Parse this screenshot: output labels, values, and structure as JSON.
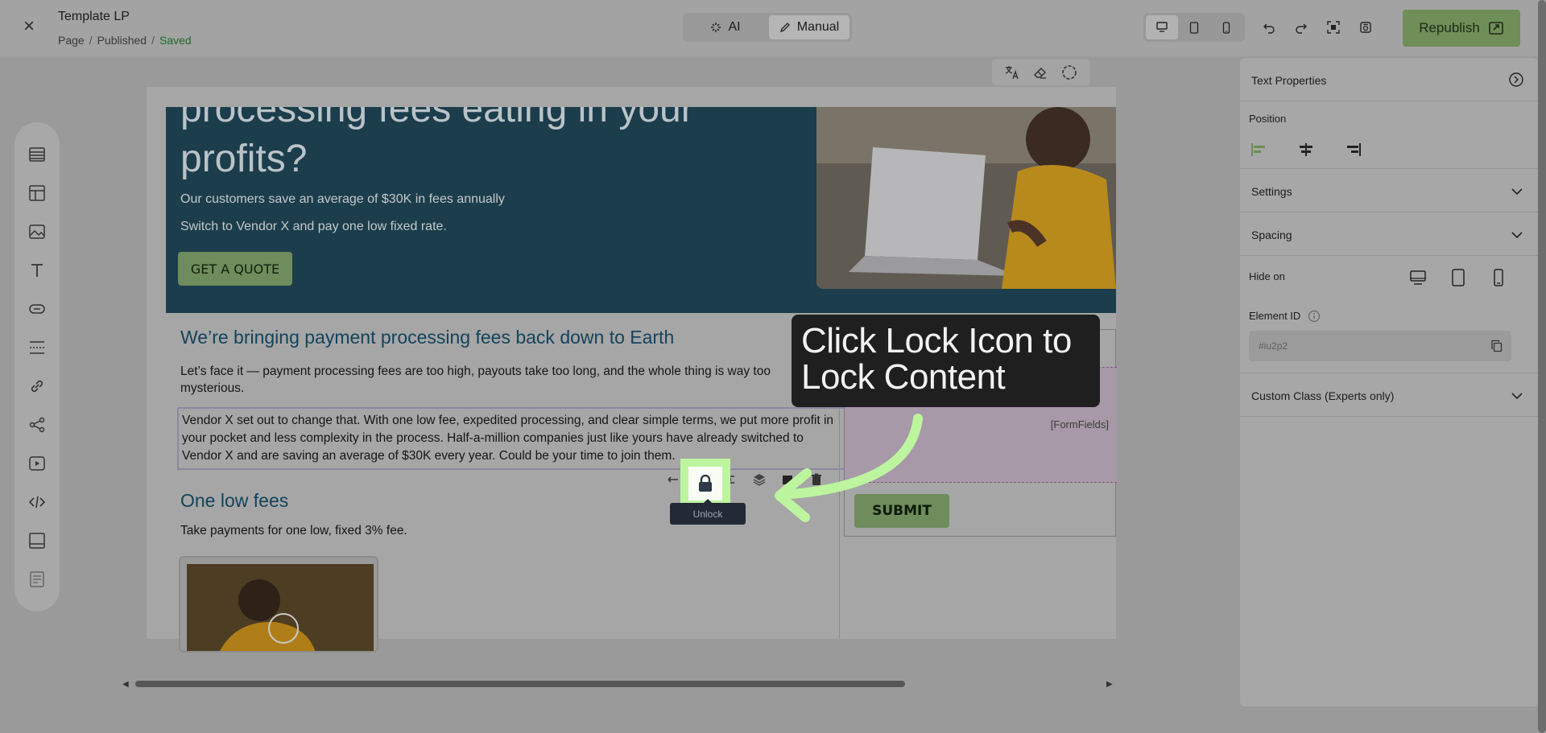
{
  "header": {
    "title": "Template LP",
    "breadcrumb": [
      "Page",
      "Published",
      "Saved"
    ],
    "breadcrumb_sep": "/",
    "modes": [
      {
        "label": "AI",
        "icon": "sparkle-icon"
      },
      {
        "label": "Manual",
        "icon": "pencil-icon"
      }
    ],
    "active_mode": "Manual",
    "republish_label": "Republish"
  },
  "canvas": {
    "hero_heading": "processing fees eating in your profits?",
    "hero_sub1": "Our customers save an average of $30K in fees annually",
    "hero_sub2": "Switch to Vendor X and pay one low fixed rate.",
    "quote_button": "GET A QUOTE",
    "section1_heading": "We’re bringing payment processing fees back down to Earth",
    "section1_p1": "Let’s face it — payment processing fees are too high, payouts take too long, and the whole thing is way too mysterious.",
    "section1_p2": "Vendor X set out to change that. With one low fee, expedited processing, and clear simple terms, we put more profit in your pocket and less complexity in the process. Half-a-million companies just like yours have already switched to Vendor X and are saving an average of $30K every year. Could be your time to join them.",
    "section2_heading": "One low fees",
    "section2_p": "Take payments for one low, fixed 3% fee.",
    "form_fields_label": "[FormFields]",
    "submit_button": "SUBMIT"
  },
  "element_toolbar": {
    "tooltip": "Unlock"
  },
  "callout": {
    "text": "Click Lock Icon to Lock Content"
  },
  "right_panel": {
    "title": "Text Properties",
    "position_label": "Position",
    "settings_label": "Settings",
    "spacing_label": "Spacing",
    "hide_on_label": "Hide on",
    "element_id_label": "Element ID",
    "element_id_value": "#iu2p2",
    "custom_class_label": "Custom Class (Experts only)"
  },
  "colors": {
    "accent_green": "#6e8c5c",
    "highlight_green": "#bdf59f",
    "saved_green": "#1d6b2b",
    "hero_bg": "#1c3d4c"
  }
}
